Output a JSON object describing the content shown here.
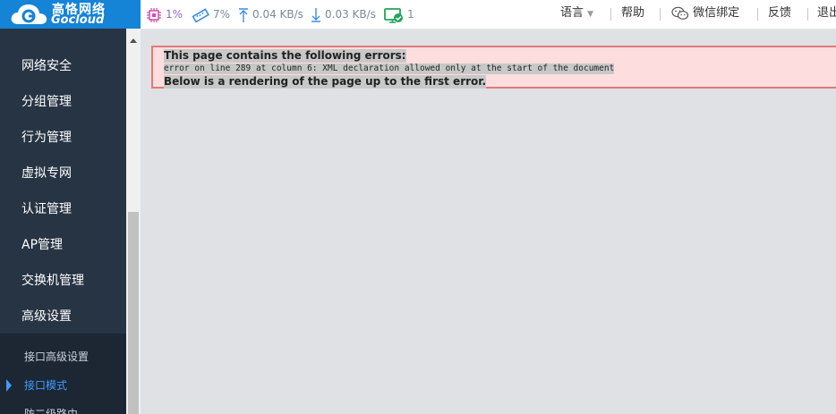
{
  "brand": {
    "name_cn": "高恪网络",
    "name_en": "Gocloud"
  },
  "status": {
    "cpu": "1%",
    "memory": "7%",
    "upload": "0.04 KB/s",
    "download": "0.03 KB/s",
    "online": "1"
  },
  "menu": {
    "language": "语言",
    "help": "帮助",
    "wechat": "微信绑定",
    "feedback": "反馈",
    "logout": "退出"
  },
  "sidebar": {
    "items": [
      {
        "label": "网络安全"
      },
      {
        "label": "分组管理"
      },
      {
        "label": "行为管理"
      },
      {
        "label": "虚拟专网"
      },
      {
        "label": "认证管理"
      },
      {
        "label": "AP管理"
      },
      {
        "label": "交换机管理"
      },
      {
        "label": "高级设置"
      }
    ],
    "submenu": [
      {
        "label": "接口高级设置"
      },
      {
        "label": "接口模式",
        "active": true
      },
      {
        "label": "防二级路由"
      }
    ]
  },
  "error": {
    "heading": "This page contains the following errors:",
    "detail": "error on line 289 at column 6: XML declaration allowed only at the start of the document",
    "footer": "Below is a rendering of the page up to the first error."
  },
  "colors": {
    "brand": "#1583d6",
    "sidebar": "#273444",
    "accent": "#3f9bff",
    "error_border": "#e07a7a"
  }
}
